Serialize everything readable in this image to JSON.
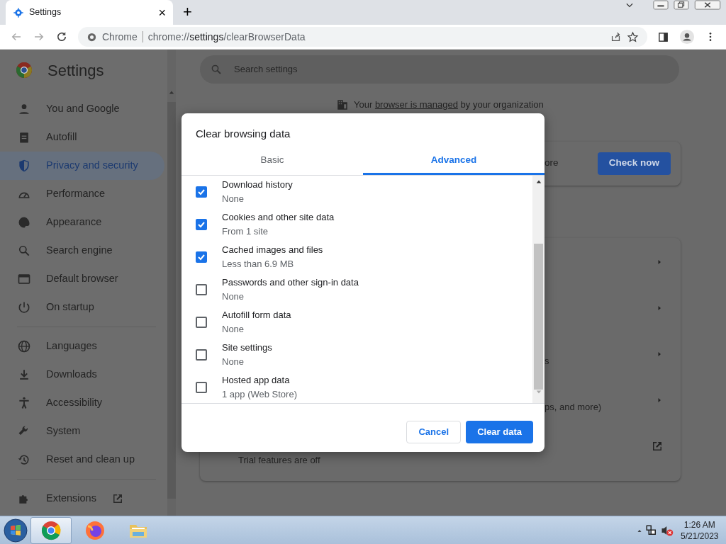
{
  "tab": {
    "title": "Settings",
    "close": "×"
  },
  "new_tab": "+",
  "omnibox": {
    "site": "Chrome",
    "url_prefix": "chrome://",
    "url_main": "settings",
    "url_suffix": "/clearBrowserData"
  },
  "settings_title": "Settings",
  "sidebar": {
    "sections": [
      [
        {
          "label": "You and Google",
          "selected": false
        },
        {
          "label": "Autofill",
          "selected": false
        },
        {
          "label": "Privacy and security",
          "selected": true
        },
        {
          "label": "Performance",
          "selected": false
        },
        {
          "label": "Appearance",
          "selected": false
        },
        {
          "label": "Search engine",
          "selected": false
        },
        {
          "label": "Default browser",
          "selected": false
        },
        {
          "label": "On startup",
          "selected": false
        }
      ],
      [
        {
          "label": "Languages",
          "selected": false
        },
        {
          "label": "Downloads",
          "selected": false
        },
        {
          "label": "Accessibility",
          "selected": false
        },
        {
          "label": "System",
          "selected": false
        },
        {
          "label": "Reset and clean up",
          "selected": false
        }
      ],
      [
        {
          "label": "Extensions",
          "selected": false,
          "kind": "external"
        }
      ]
    ]
  },
  "search": {
    "placeholder": "Search settings"
  },
  "managed_notice": {
    "before": "Your",
    "link": "browser is managed",
    "after": "by your organization"
  },
  "safety_card": {
    "text": "ore",
    "button": "Check now"
  },
  "privacy_card": {
    "rows": [
      {
        "kind": "arrow"
      },
      {
        "kind": "arrow"
      },
      {
        "kind": "arrow",
        "text": "s"
      },
      {
        "kind": "arrow",
        "text": "ps, and more)"
      },
      {
        "kind": "external",
        "text": "Trial features are off"
      }
    ]
  },
  "dialog": {
    "title": "Clear browsing data",
    "tabs": [
      {
        "label": "Basic",
        "selected": false
      },
      {
        "label": "Advanced",
        "selected": true
      }
    ],
    "items": [
      {
        "title": "Download history",
        "detail": "None",
        "checked": true
      },
      {
        "title": "Cookies and other site data",
        "detail": "From 1 site",
        "checked": true
      },
      {
        "title": "Cached images and files",
        "detail": "Less than 6.9 MB",
        "checked": true
      },
      {
        "title": "Passwords and other sign-in data",
        "detail": "None",
        "checked": false
      },
      {
        "title": "Autofill form data",
        "detail": "None",
        "checked": false
      },
      {
        "title": "Site settings",
        "detail": "None",
        "checked": false
      },
      {
        "title": "Hosted app data",
        "detail": "1 app (Web Store)",
        "checked": false
      }
    ],
    "cancel": "Cancel",
    "confirm": "Clear data"
  },
  "taskbar": {
    "apps": [
      {
        "kind": "chrome",
        "selected": true
      },
      {
        "kind": "firefox",
        "selected": false
      },
      {
        "kind": "folder",
        "selected": false
      }
    ],
    "time": "1:26 AM",
    "date": "5/21/2023"
  }
}
